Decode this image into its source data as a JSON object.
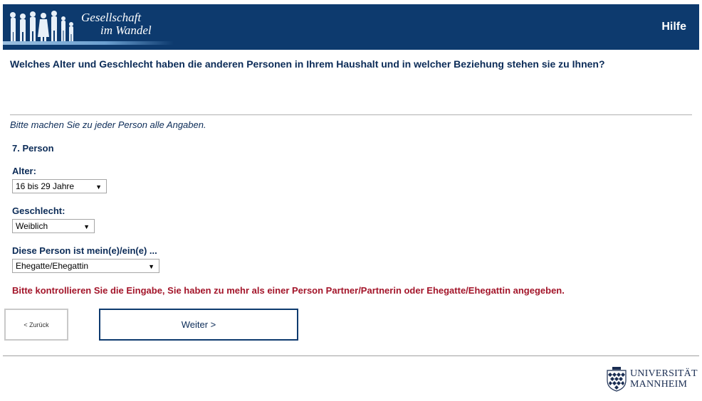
{
  "header": {
    "logo_line1": "Gesellschaft",
    "logo_line2": "im Wandel",
    "help_label": "Hilfe",
    "background_color": "#0d3a6e"
  },
  "question": "Welches Alter und Geschlecht haben die anderen Personen in Ihrem Haushalt und in welcher Beziehung stehen sie zu Ihnen?",
  "instruction": "Bitte machen Sie zu jeder Person alle Angaben.",
  "person_title": "7. Person",
  "fields": {
    "age": {
      "label": "Alter:",
      "value": "16 bis 29 Jahre"
    },
    "gender": {
      "label": "Geschlecht:",
      "value": "Weiblich"
    },
    "relation": {
      "label": "Diese Person ist mein(e)/ein(e) ...",
      "value": "Ehegatte/Ehegattin"
    }
  },
  "error_message": "Bitte kontrollieren Sie die Eingabe, Sie haben zu mehr als einer Person Partner/Partnerin oder Ehegatte/Ehegattin angegeben.",
  "error_color": "#a3152a",
  "buttons": {
    "back_label": "< Zurück",
    "next_label": "Weiter >"
  },
  "footer": {
    "university_line1": "UNIVERSITÄT",
    "university_line2": "MANNHEIM",
    "crest_icon": "university-crest-icon"
  }
}
